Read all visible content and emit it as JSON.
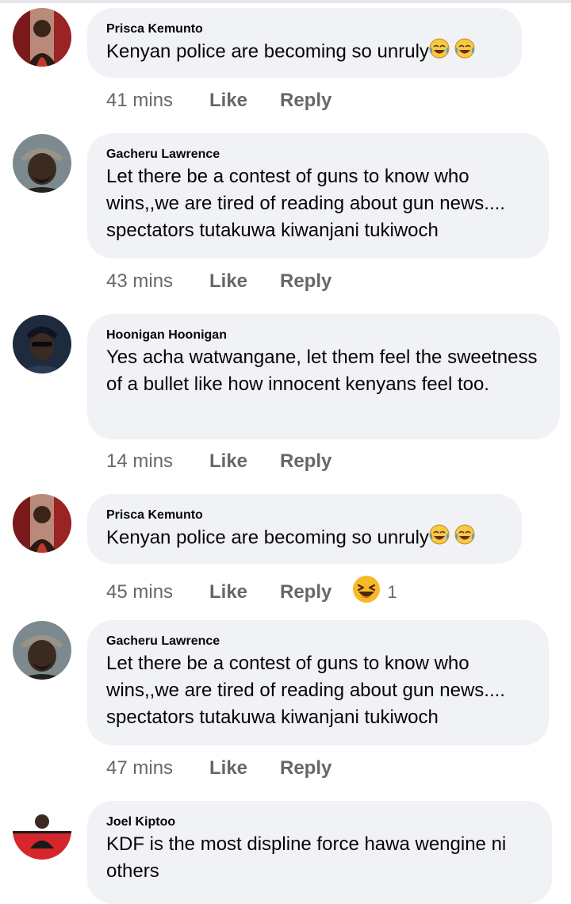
{
  "comments": [
    {
      "author": "Prisca Kemunto",
      "text": "Kenyan police are becoming so unruly",
      "emojis": [
        "laughing-crying-emoji",
        "laughing-crying-emoji"
      ],
      "time": "41 mins",
      "like": "Like",
      "reply": "Reply",
      "avatar": "prisca-avatar"
    },
    {
      "author": "Gacheru Lawrence",
      "text": "Let there be a contest of guns to know who wins,,we are tired of reading about gun news.... spectators tutakuwa kiwanjani tukiwoch",
      "time": "43 mins",
      "like": "Like",
      "reply": "Reply",
      "avatar": "gacheru-avatar"
    },
    {
      "author": "Hoonigan Hoonigan",
      "text": "Yes acha watwangane, let them feel the sweetness of a bullet like how innocent kenyans feel too.",
      "time": "14 mins",
      "like": "Like",
      "reply": "Reply",
      "avatar": "hoonigan-avatar"
    },
    {
      "author": "Prisca Kemunto",
      "text": "Kenyan police are becoming so unruly",
      "emojis": [
        "laughing-crying-emoji",
        "laughing-crying-emoji"
      ],
      "time": "45 mins",
      "like": "Like",
      "reply": "Reply",
      "reaction": {
        "icon": "haha-reaction-icon",
        "count": "1"
      },
      "avatar": "prisca-avatar"
    },
    {
      "author": "Gacheru Lawrence",
      "text": "Let there be a contest of guns to know who wins,,we are tired of reading about gun news.... spectators tutakuwa kiwanjani tukiwoch",
      "time": "47 mins",
      "like": "Like",
      "reply": "Reply",
      "avatar": "gacheru-avatar"
    },
    {
      "author": "Joel Kiptoo",
      "text": "KDF is the most displine force hawa wengine ni others",
      "avatar": "joel-avatar"
    }
  ]
}
